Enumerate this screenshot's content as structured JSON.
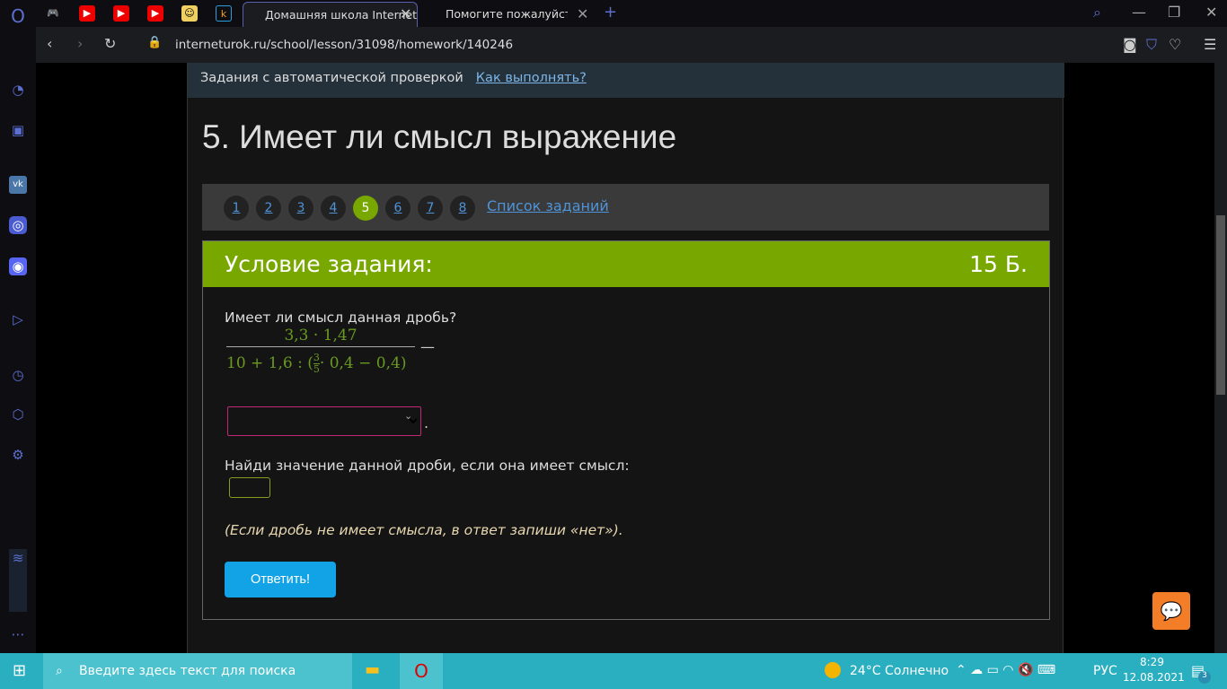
{
  "browser": {
    "tabs": [
      {
        "title": "Домашняя школа Interneturok",
        "active": true
      },
      {
        "title": "Помогите пожалуйста( - Uchi",
        "active": false
      }
    ],
    "url": "interneturok.ru/school/lesson/31098/homework/140246"
  },
  "page": {
    "header_text": "Задания с автоматической проверкой",
    "header_link": "Как выполнять?",
    "title": "5. Имеет ли смысл выражение",
    "task_numbers": [
      "1",
      "2",
      "3",
      "4",
      "5",
      "6",
      "7",
      "8"
    ],
    "current_task": "5",
    "task_list_link": "Список заданий",
    "condition_label": "Условие задания:",
    "points": "15 Б.",
    "question1": "Имеет ли смысл данная дробь?",
    "numerator": "3,3 · 1,47",
    "denominator_a": "10 + 1,6 : (",
    "frac_num": "3",
    "frac_den": "5",
    "denominator_b": "· 0,4 − 0,4)",
    "dash": "—",
    "period": ".",
    "question2": "Найди значение данной дроби, если она имеет смысл:",
    "note": "(Если дробь не имеет смысла, в ответ запиши «нет»).",
    "submit": "Ответить!"
  },
  "taskbar": {
    "search_placeholder": "Введите здесь текст для поиска",
    "weather": "24°C  Солнечно",
    "lang": "РУС",
    "time": "8:29",
    "date": "12.08.2021",
    "notifications": "3"
  }
}
